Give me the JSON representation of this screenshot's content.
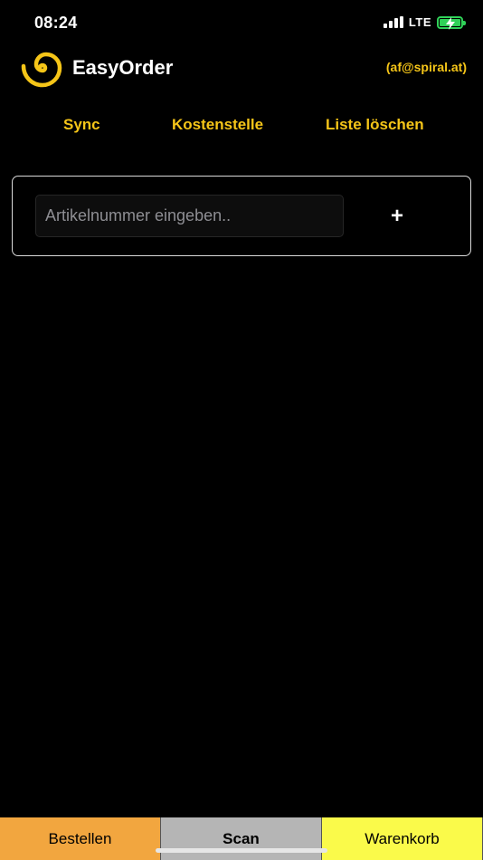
{
  "status_bar": {
    "time": "08:24",
    "network": "LTE"
  },
  "header": {
    "title": "EasyOrder",
    "account": "(af@spiral.at)"
  },
  "actions": {
    "sync": "Sync",
    "cost_center": "Kostenstelle",
    "clear_list": "Liste löschen"
  },
  "entry": {
    "placeholder": "Artikelnummer eingeben..",
    "value": "",
    "add_label": "+"
  },
  "tabs": [
    {
      "label": "Bestellen",
      "color": "#f2a63f",
      "active": false
    },
    {
      "label": "Scan",
      "color": "#b5b5b5",
      "active": true
    },
    {
      "label": "Warenkorb",
      "color": "#fafa4a",
      "active": false
    }
  ],
  "colors": {
    "accent": "#f5c518",
    "background": "#000000",
    "battery": "#30d158"
  },
  "icons": {
    "logo": "spiral-logo-icon",
    "signal": "signal-icon",
    "battery": "battery-charging-icon"
  }
}
